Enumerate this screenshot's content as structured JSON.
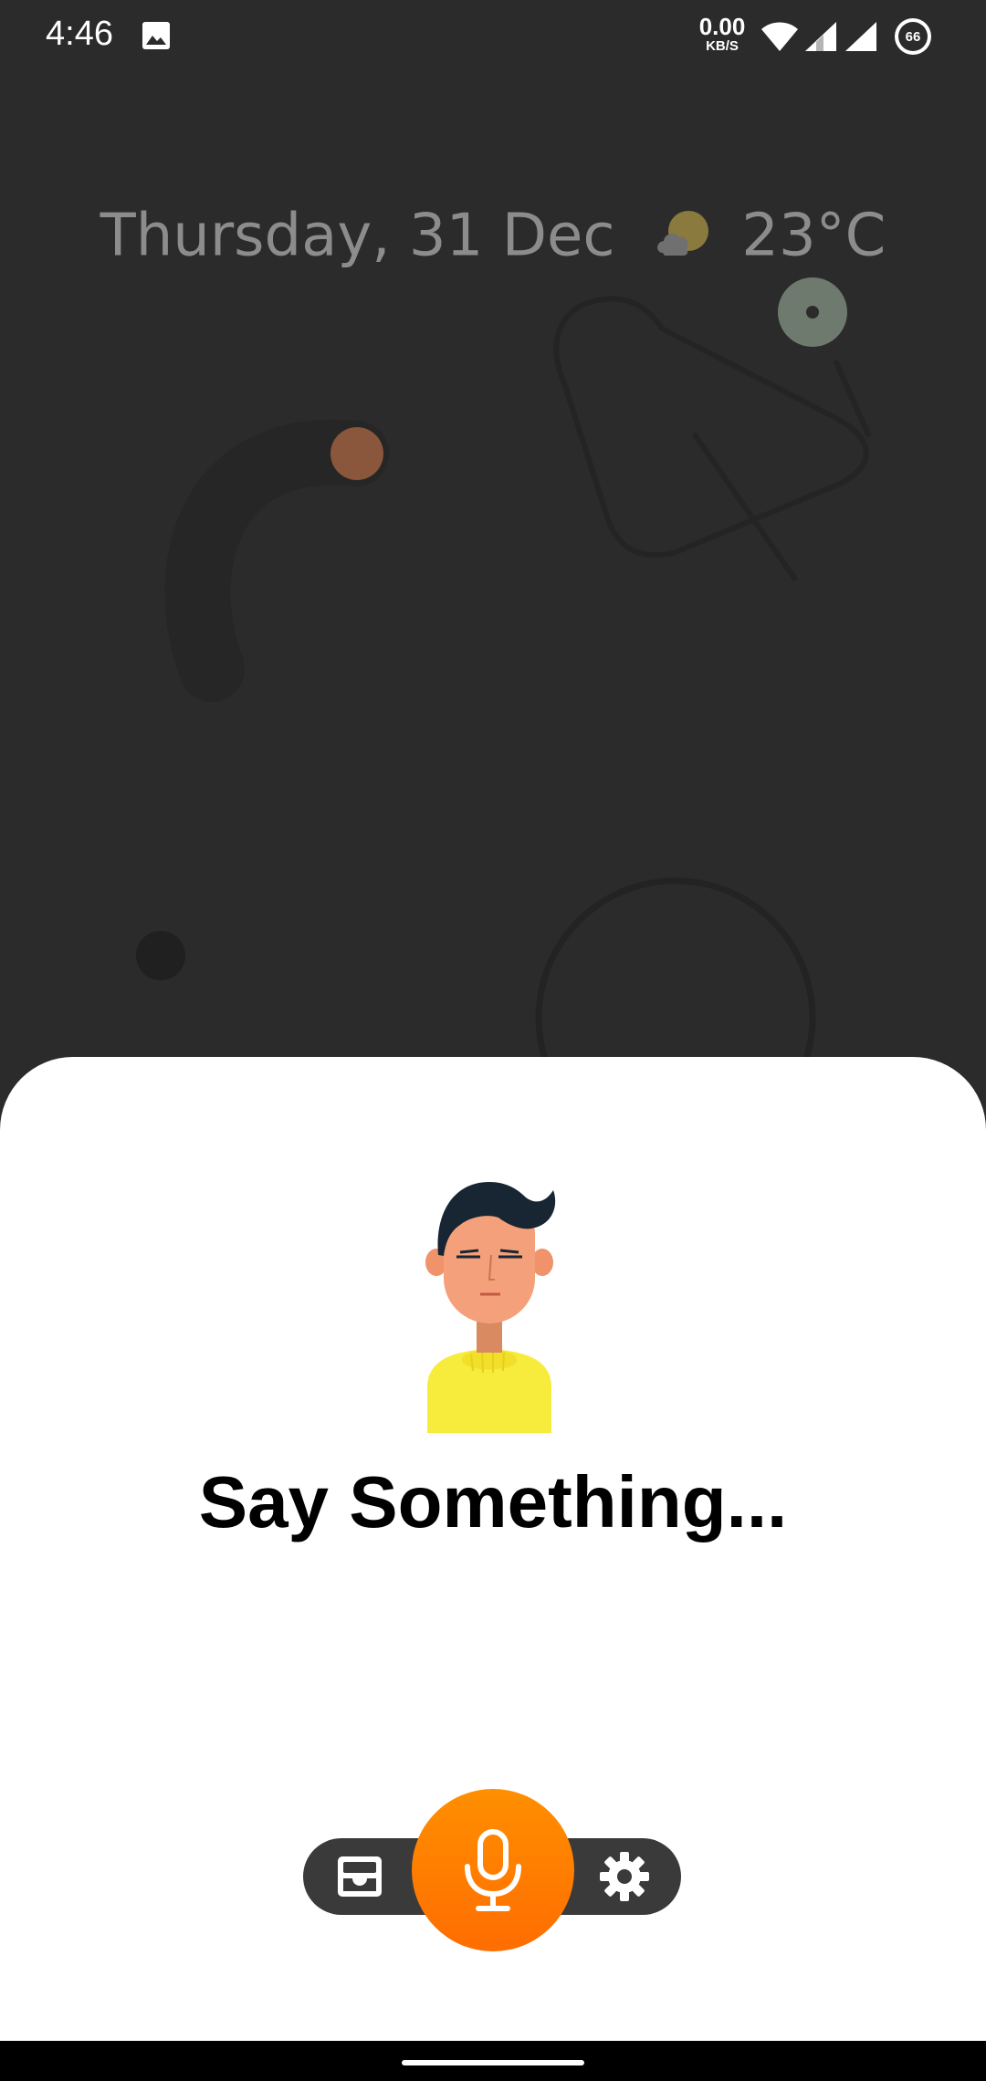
{
  "status_bar": {
    "time": "4:46",
    "network_speed_value": "0.00",
    "network_speed_unit": "KB/S",
    "battery_level": "66",
    "icons": [
      "gallery-icon",
      "wifi-icon",
      "signal-icon",
      "signal-icon",
      "battery-icon"
    ]
  },
  "wallpaper": {
    "date": "Thursday, 31 Dec",
    "weather_icon": "partly-cloudy-icon",
    "temperature": "23°C"
  },
  "assistant": {
    "prompt": "Say Something...",
    "avatar": "avatar-illustration"
  },
  "controls": {
    "left_icon": "inbox-icon",
    "center_icon": "mic-icon",
    "right_icon": "settings-icon"
  },
  "colors": {
    "background": "#2b2b2b",
    "sheet": "#ffffff",
    "mic_accent": "#ff7a00",
    "pill": "#3a3a3a"
  }
}
